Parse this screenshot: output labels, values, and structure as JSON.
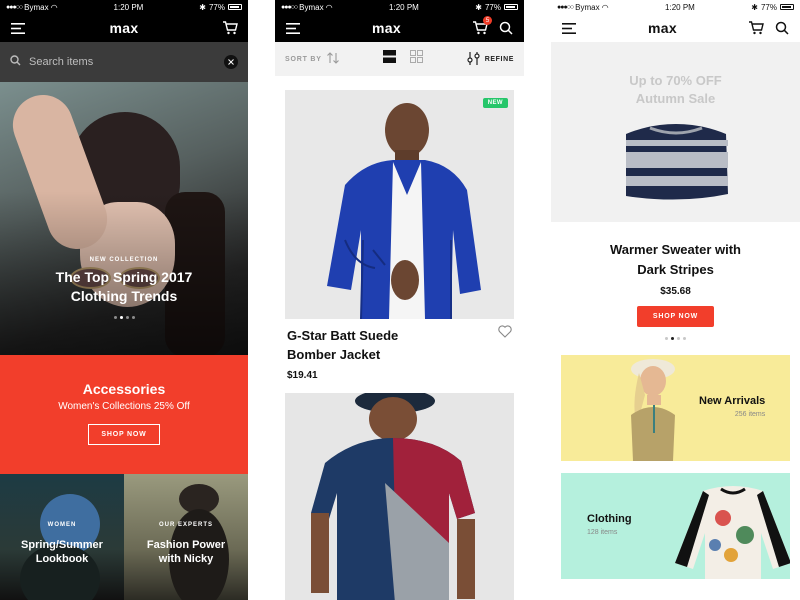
{
  "status_bar": {
    "carrier": "Bymax",
    "time": "1:20 PM",
    "battery": "77%"
  },
  "app": {
    "logo": "max"
  },
  "screen1": {
    "search": {
      "placeholder": "Search items"
    },
    "hero": {
      "eyebrow": "NEW COLLECTION",
      "title_line1": "The Top Spring 2017",
      "title_line2": "Clothing Trends"
    },
    "promo": {
      "title": "Accessories",
      "subtitle": "Women's Collections 25% Off",
      "button": "SHOP NOW",
      "color": "#f23e2b"
    },
    "tiles": [
      {
        "eyebrow": "WOMEN",
        "title_line1": "Spring/Summer",
        "title_line2": "Lookbook"
      },
      {
        "eyebrow": "OUR EXPERTS",
        "title_line1": "Fashion Power",
        "title_line2": "with Nicky"
      }
    ]
  },
  "screen2": {
    "cart_count": "5",
    "toolbar": {
      "sort_label": "SORT BY",
      "refine_label": "REFINE"
    },
    "products": [
      {
        "badge": "NEW",
        "name_line1": "G-Star Batt Suede",
        "name_line2": "Bomber Jacket",
        "price": "$19.41"
      }
    ]
  },
  "screen3": {
    "sale": {
      "line1": "Up to 70% OFF",
      "line2": "Autumn Sale"
    },
    "featured": {
      "name_line1": "Warmer Sweater with",
      "name_line2": "Dark Stripes",
      "price": "$35.68",
      "button": "SHOP NOW"
    },
    "categories": [
      {
        "title": "New Arrivals",
        "count": "256 items",
        "color": "#f8eb99"
      },
      {
        "title": "Clothing",
        "count": "128 items",
        "color": "#b5f0dd"
      }
    ]
  },
  "icons": [
    "menu-icon",
    "cart-icon",
    "search-icon",
    "close-icon",
    "sort-icon",
    "list-view-icon",
    "grid-view-icon",
    "filter-icon",
    "heart-icon"
  ]
}
